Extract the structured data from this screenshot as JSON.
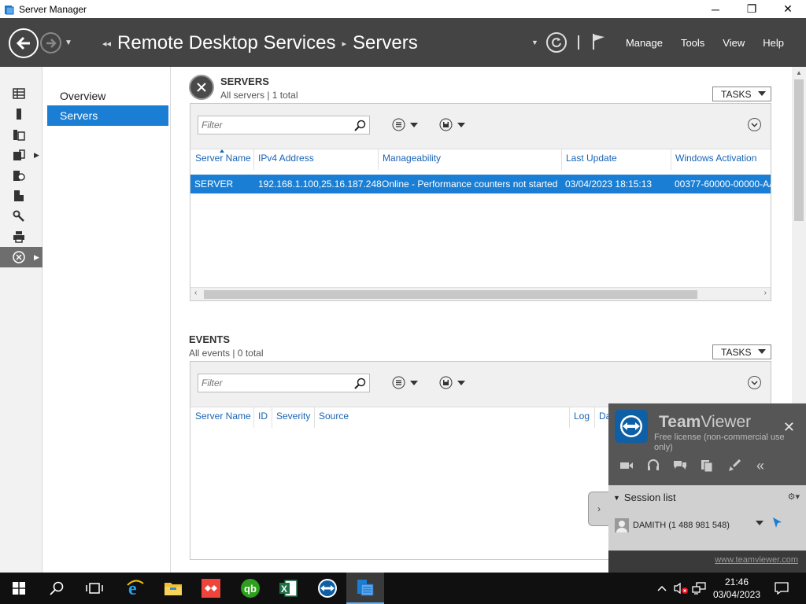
{
  "window": {
    "title": "Server Manager",
    "controls": {
      "minimize": "─",
      "maximize": "❐",
      "close": "✕"
    }
  },
  "header": {
    "breadcrumb_root": "Remote Desktop Services",
    "breadcrumb_leaf": "Servers",
    "menus": [
      "Manage",
      "Tools",
      "View",
      "Help"
    ]
  },
  "rail": {
    "items": [
      {
        "icon": "dashboard-icon"
      },
      {
        "icon": "local-server-icon"
      },
      {
        "icon": "all-servers-icon"
      },
      {
        "icon": "file-storage-icon",
        "expandable": true
      },
      {
        "icon": "iis-icon"
      },
      {
        "icon": "server-group-icon"
      },
      {
        "icon": "tools-icon"
      },
      {
        "icon": "print-services-icon"
      },
      {
        "icon": "remote-desktop-services-icon",
        "expandable": true,
        "active": true
      }
    ]
  },
  "subnav": {
    "items": [
      {
        "label": "Overview",
        "active": false
      },
      {
        "label": "Servers",
        "active": true
      }
    ]
  },
  "servers": {
    "title": "SERVERS",
    "subtitle": "All servers | 1 total",
    "tasks_label": "TASKS",
    "filter_placeholder": "Filter",
    "columns": [
      "Server Name",
      "IPv4 Address",
      "Manageability",
      "Last Update",
      "Windows Activation"
    ],
    "sorted_column": "Server Name",
    "rows": [
      {
        "name": "SERVER",
        "ipv4": "192.168.1.100,25.16.187.248",
        "manageability": "Online - Performance counters not started",
        "last_update": "03/04/2023 18:15:13",
        "activation": "00377-60000-00000-AA"
      }
    ]
  },
  "events": {
    "title": "EVENTS",
    "subtitle": "All events | 0 total",
    "tasks_label": "TASKS",
    "filter_placeholder": "Filter",
    "columns": [
      "Server Name",
      "ID",
      "Severity",
      "Source",
      "Log",
      "Da"
    ]
  },
  "teamviewer": {
    "brand_bold": "Team",
    "brand_light": "Viewer",
    "license": "Free license (non-commercial use only)",
    "session_list_label": "Session list",
    "session_item": "DAMITH (1 488 981 548)",
    "website": "www.teamviewer.com",
    "accent": "#0e5fa5"
  },
  "taskbar": {
    "apps": [
      "start-icon",
      "search-icon",
      "task-view-icon",
      "internet-explorer-icon",
      "file-explorer-icon",
      "anydesk-icon",
      "quickbooks-icon",
      "excel-icon",
      "teamviewer-icon",
      "server-manager-icon"
    ],
    "active_app": "server-manager-icon",
    "clock_time": "21:46",
    "clock_date": "03/04/2023"
  },
  "colors": {
    "header_bg": "#444444",
    "selection": "#1a7fd4",
    "link_text": "#1a64b4"
  }
}
